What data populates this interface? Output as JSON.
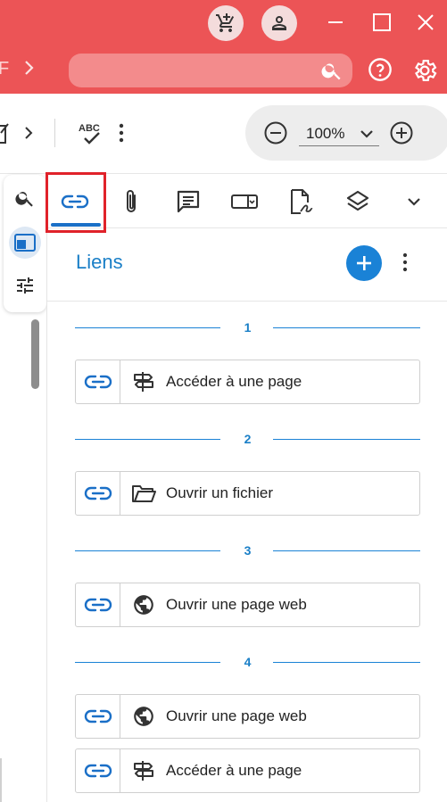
{
  "titlebar": {
    "left_cut_text": "F",
    "search": {
      "placeholder": "",
      "value": ""
    },
    "icons": [
      "cart-icon",
      "account-icon",
      "minimize-icon",
      "maximize-icon",
      "close-icon",
      "chevron-right-icon",
      "search-icon",
      "help-icon",
      "gear-icon"
    ]
  },
  "toolbar": {
    "zoom": {
      "value": "100%"
    },
    "icons": [
      "edit-icon",
      "chevron-right-icon",
      "spellcheck-icon",
      "more-vert-icon",
      "zoom-out-icon",
      "zoom-in-icon"
    ]
  },
  "rail": {
    "icons": [
      "search-icon",
      "panel-icon",
      "sliders-icon"
    ]
  },
  "panel": {
    "tabs": [
      {
        "name": "tab-links",
        "icon": "link-icon",
        "active": true
      },
      {
        "name": "tab-attachments",
        "icon": "paperclip-icon"
      },
      {
        "name": "tab-comments",
        "icon": "comment-icon"
      },
      {
        "name": "tab-fields",
        "icon": "form-field-icon"
      },
      {
        "name": "tab-signature",
        "icon": "signature-icon"
      },
      {
        "name": "tab-layers",
        "icon": "layers-icon"
      },
      {
        "name": "tab-more",
        "icon": "chevron-down-icon"
      }
    ],
    "title": "Liens",
    "groups": [
      {
        "page": "1",
        "items": [
          {
            "label": "Accéder à une page",
            "type_icon": "signpost-icon"
          }
        ]
      },
      {
        "page": "2",
        "items": [
          {
            "label": "Ouvrir un fichier",
            "type_icon": "folder-open-icon"
          }
        ]
      },
      {
        "page": "3",
        "items": [
          {
            "label": "Ouvrir une page web",
            "type_icon": "globe-icon"
          }
        ]
      },
      {
        "page": "4",
        "items": [
          {
            "label": "Ouvrir une page web",
            "type_icon": "globe-icon"
          },
          {
            "label": "Accéder à une page",
            "type_icon": "signpost-icon"
          }
        ]
      }
    ]
  },
  "colors": {
    "titlebar_bg": "#ec5456",
    "accent": "#1a82d6",
    "highlight_box": "#e0222a"
  }
}
